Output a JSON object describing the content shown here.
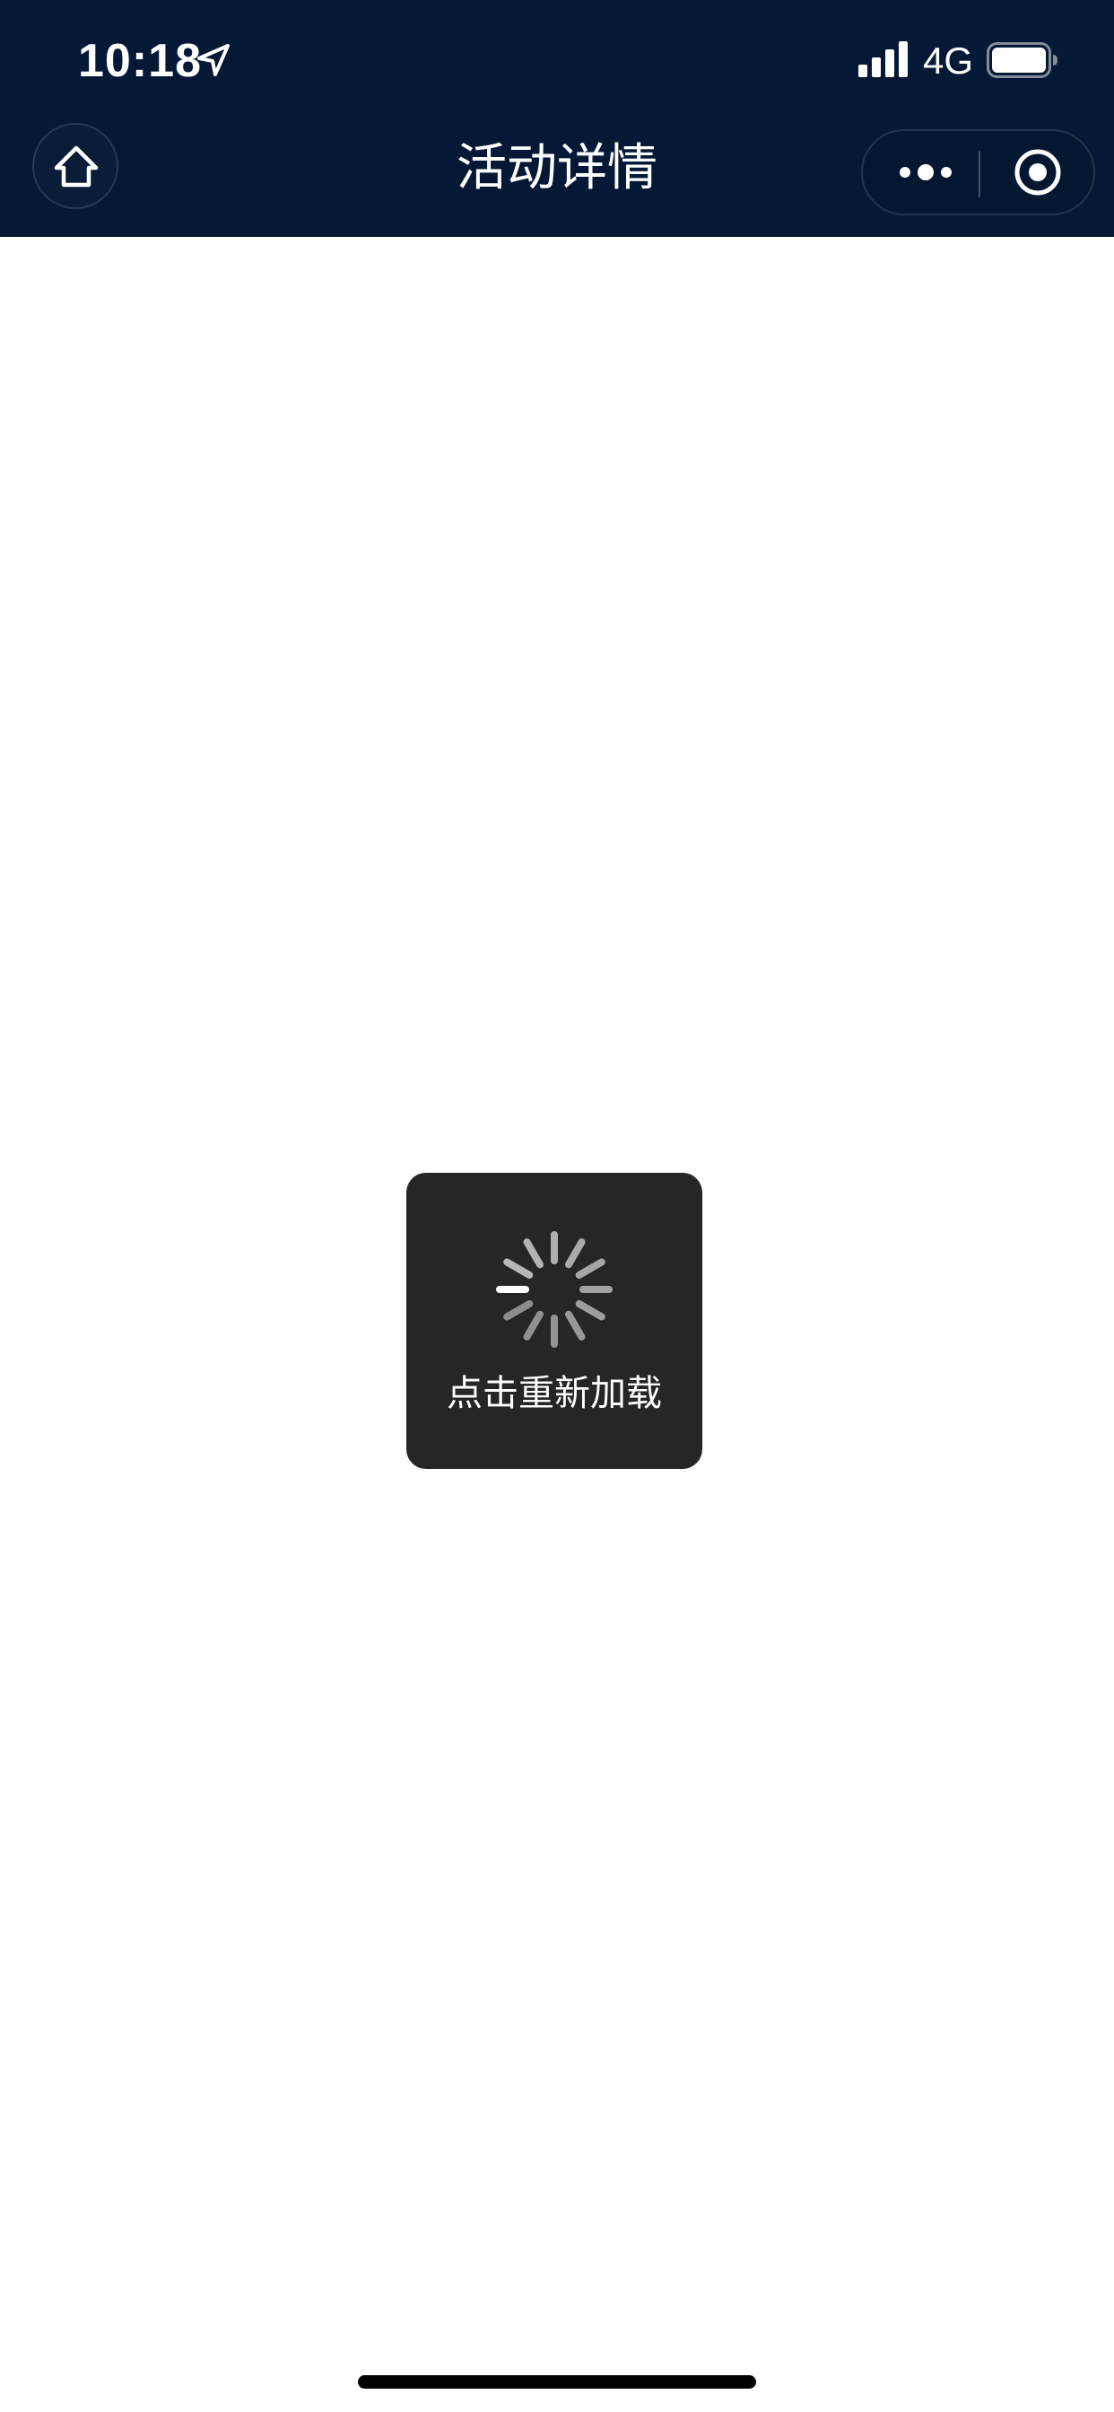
{
  "status_bar": {
    "time": "10:18",
    "network": "4G"
  },
  "nav_bar": {
    "title": "活动详情"
  },
  "loading_toast": {
    "label": "点击重新加载"
  },
  "icons": {
    "location": "location-arrow-icon",
    "signal": "cellular-signal-icon",
    "battery": "battery-icon",
    "home": "home-icon",
    "more": "more-dots-icon",
    "close": "close-circle-icon",
    "spinner": "loading-spinner-icon"
  },
  "colors": {
    "header_background": "#051936",
    "toast_background": "#262626",
    "page_background": "#ffffff"
  }
}
